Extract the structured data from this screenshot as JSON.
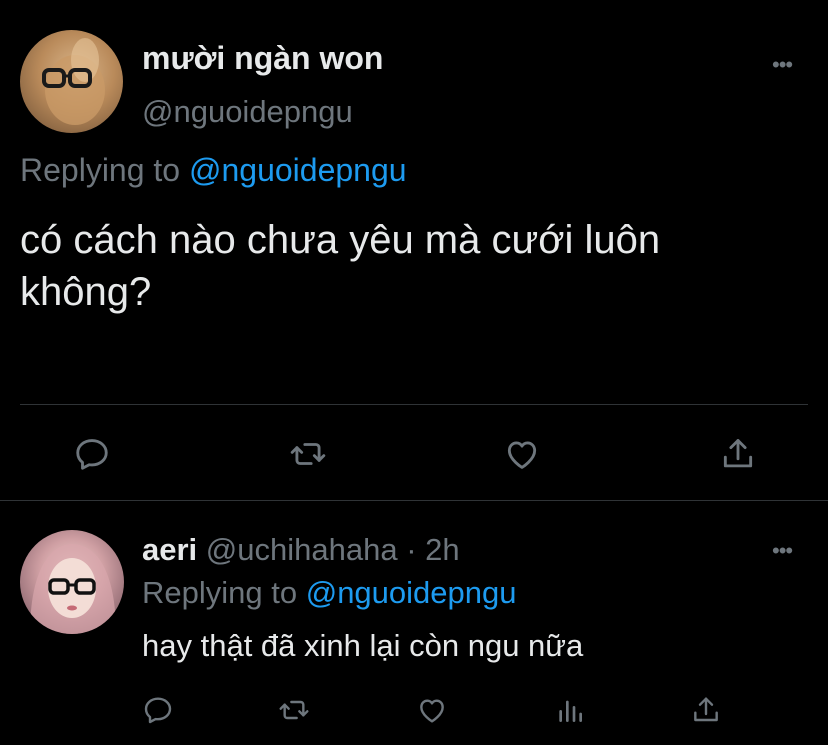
{
  "main_tweet": {
    "display_name": "mười ngàn won",
    "handle": "@nguoidepngu",
    "replying_prefix": "Replying to",
    "replying_to": "@nguoidepngu",
    "text_line1": "có cách nào chưa yêu mà cưới luôn",
    "text_line2": "không?",
    "more": "•••",
    "actions": [
      "reply-icon",
      "retweet-icon",
      "like-icon",
      "share-icon"
    ]
  },
  "reply_tweet": {
    "display_name": "aeri",
    "handle": "@uchihahaha",
    "separator": "·",
    "time": "2h",
    "replying_prefix": "Replying to",
    "replying_to": "@nguoidepngu",
    "text": "hay thật đã xinh lại còn ngu nữa",
    "more": "•••",
    "actions": [
      "reply-icon",
      "retweet-icon",
      "like-icon",
      "analytics-icon",
      "share-icon"
    ]
  },
  "colors": {
    "background": "#000000",
    "text": "#e7e9ea",
    "muted": "#6e767d",
    "link": "#1d9bf0",
    "divider": "#2f3336"
  }
}
